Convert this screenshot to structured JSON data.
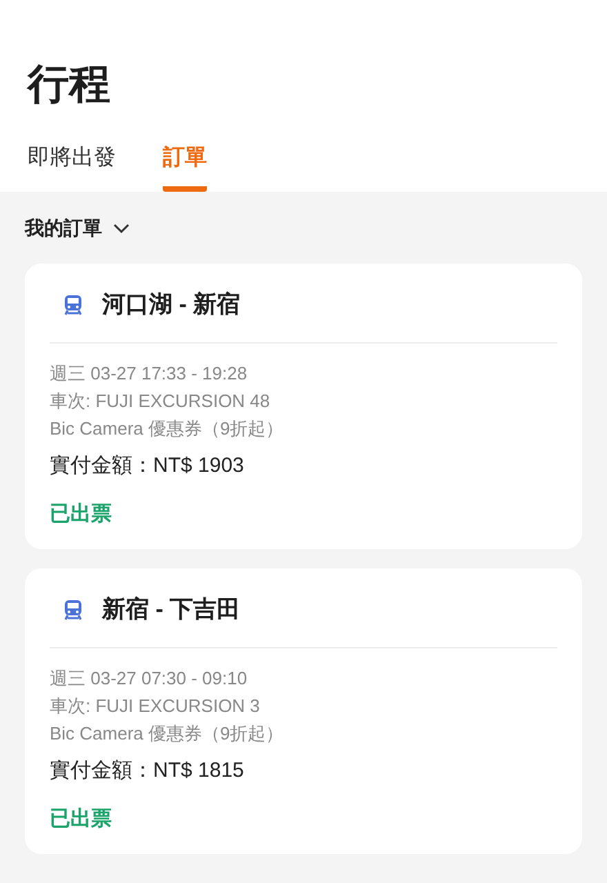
{
  "title": "行程",
  "tabs": [
    {
      "label": "即將出發",
      "selected": false
    },
    {
      "label": "訂單",
      "selected": true
    }
  ],
  "filter": {
    "label": "我的訂單"
  },
  "orders": [
    {
      "route": "河口湖 - 新宿",
      "schedule": "週三 03-27 17:33 - 19:28",
      "train": "車次: FUJI EXCURSION 48",
      "coupon": "Bic Camera 優惠券（9折起）",
      "price": "實付金額：NT$ 1903",
      "status": "已出票"
    },
    {
      "route": "新宿 - 下吉田",
      "schedule": "週三 03-27 07:30 - 09:10",
      "train": "車次: FUJI EXCURSION 3",
      "coupon": "Bic Camera 優惠券（9折起）",
      "price": "實付金額：NT$ 1815",
      "status": "已出票"
    }
  ]
}
